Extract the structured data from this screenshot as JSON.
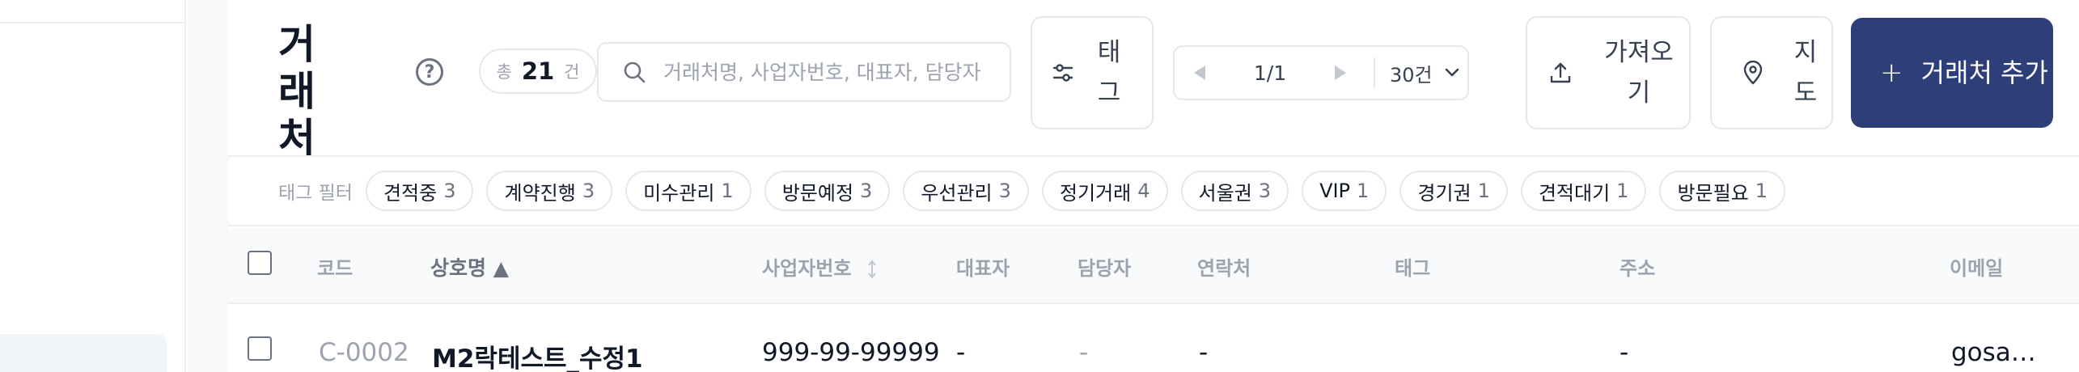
{
  "page": {
    "title": "거래처",
    "help_glyph": "?"
  },
  "count": {
    "prefix": "총",
    "value": "21",
    "suffix": "건"
  },
  "search": {
    "placeholder": "거래처명, 사업자번호, 대표자, 담당자"
  },
  "toolbar": {
    "tag_label": "태그",
    "import_label": "가져오기",
    "map_label": "지도",
    "add_label": "거래처 추가",
    "add_icon": "+"
  },
  "pager": {
    "pages": "1/1",
    "per_page": "30건"
  },
  "filters": {
    "label": "태그 필터",
    "chips": [
      {
        "name": "견적중",
        "count": "3"
      },
      {
        "name": "계약진행",
        "count": "3"
      },
      {
        "name": "미수관리",
        "count": "1"
      },
      {
        "name": "방문예정",
        "count": "3"
      },
      {
        "name": "우선관리",
        "count": "3"
      },
      {
        "name": "정기거래",
        "count": "4"
      },
      {
        "name": "서울권",
        "count": "3"
      },
      {
        "name": "VIP",
        "count": "1"
      },
      {
        "name": "경기권",
        "count": "1"
      },
      {
        "name": "견적대기",
        "count": "1"
      },
      {
        "name": "방문필요",
        "count": "1"
      }
    ]
  },
  "table": {
    "columns": {
      "code": "코드",
      "name": "상호명 ▲",
      "biz_no": "사업자번호",
      "ceo": "대표자",
      "manager": "담당자",
      "contact": "연락처",
      "tags": "태그",
      "address": "주소",
      "email": "이메일"
    },
    "rows": [
      {
        "code": "C-0002",
        "name": "M2락테스트_수정1",
        "biz_no": "999-99-99999",
        "ceo": "-",
        "manager": "-",
        "contact": "-",
        "tags": "",
        "address": "-",
        "email": "gosa…"
      }
    ]
  },
  "colors": {
    "primary": "#2e3e78",
    "border": "#e5e7eb",
    "muted_text": "#9ca3af"
  }
}
